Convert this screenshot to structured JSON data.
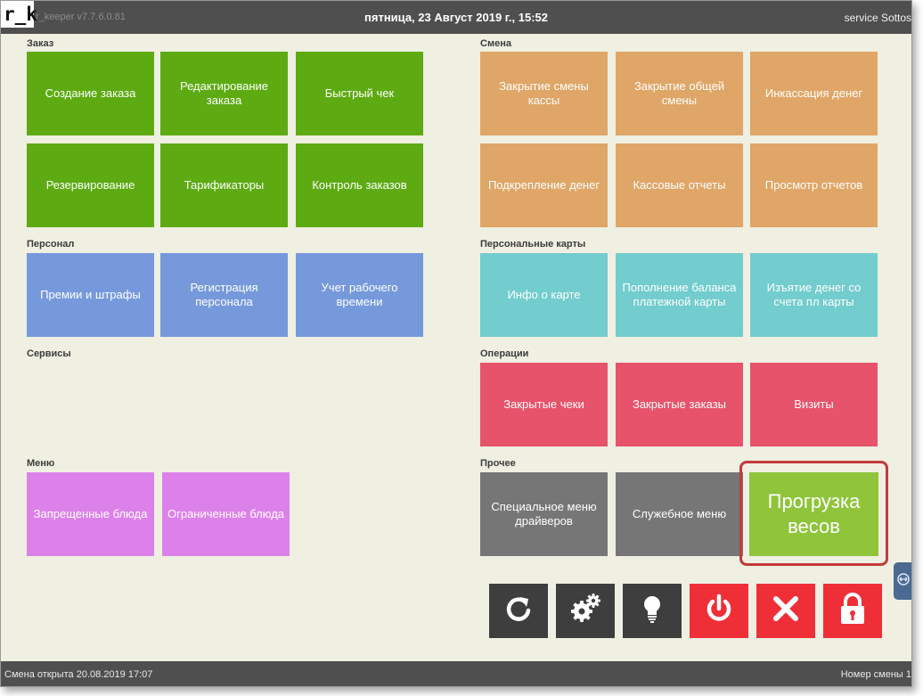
{
  "topbar": {
    "logo": "r_k",
    "version": "r_keeper v7.7.6.0.81",
    "datetime": "пятница, 23 Август 2019 г., 15:52",
    "user": "service Sottos"
  },
  "groups": {
    "order": "Заказ",
    "shift": "Смена",
    "staff": "Персонал",
    "cards": "Персональные карты",
    "services": "Сервисы",
    "operations": "Операции",
    "menu": "Меню",
    "other": "Прочее"
  },
  "tiles": {
    "create_order": "Создание заказа",
    "edit_order": "Редактирование заказа",
    "quick_check": "Быстрый чек",
    "reservation": "Резервирование",
    "tariffs": "Тарификаторы",
    "order_control": "Контроль заказов",
    "close_cash_shift": "Закрытие смены кассы",
    "close_common_shift": "Закрытие общей смены",
    "cash_collection": "Инкассация денег",
    "cash_reinforcement": "Подкрепление денег",
    "cash_reports": "Кассовые отчеты",
    "view_reports": "Просмотр отчетов",
    "bonuses_fines": "Премии и штрафы",
    "staff_registration": "Регистрация персонала",
    "time_tracking": "Учет рабочего времени",
    "card_info": "Инфо о карте",
    "top_up_card": "Пополнение баланса платежной карты",
    "withdraw_card": "Изъятие денег со счета пл карты",
    "closed_checks": "Закрытые чеки",
    "closed_orders": "Закрытые заказы",
    "visits": "Визиты",
    "banned_dishes": "Запрещенные блюда",
    "limited_dishes": "Ограниченные блюда",
    "driver_menu": "Специальное меню драйверов",
    "service_menu": "Служебное меню",
    "upload_scales": "Прогрузка весов"
  },
  "actions": {
    "refresh": "refresh-icon",
    "settings": "gears-icon",
    "hint": "lightbulb-icon",
    "power": "power-icon",
    "close": "close-icon",
    "lock": "lock-icon"
  },
  "colors": {
    "green": "#5daa12",
    "orange": "#dfa667",
    "blue": "#7699dc",
    "cyan": "#73cccd",
    "red": "#e6536a",
    "violet": "#dd81ea",
    "gray": "#767676",
    "lime": "#8fc43b",
    "highlight": "#c43a3a"
  },
  "statusbar": {
    "shift_open": "Смена открыта 20.08.2019 17:07",
    "shift_number": "Номер смены 1"
  }
}
